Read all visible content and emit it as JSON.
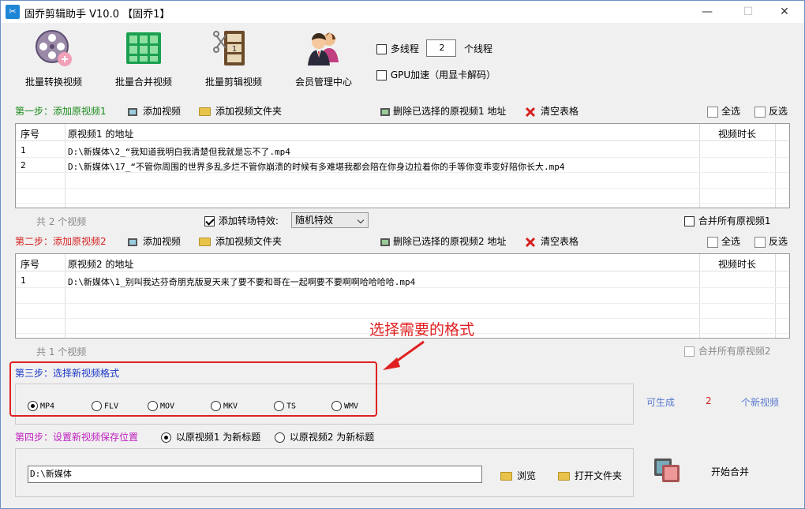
{
  "window": {
    "title": "固乔剪辑助手 V10.0  【固乔1】",
    "minimize": "—",
    "maximize": "☐",
    "close": "✕"
  },
  "toolbar": {
    "items": [
      {
        "label": "批量转换视频",
        "icon": "film-reel-icon"
      },
      {
        "label": "批量合并视频",
        "icon": "merge-grid-icon"
      },
      {
        "label": "批量剪辑视频",
        "icon": "film-scissors-icon"
      },
      {
        "label": "会员管理中心",
        "icon": "users-icon"
      }
    ],
    "multithread_label": "多线程",
    "thread_count": "2",
    "thread_unit": "个线程",
    "gpu_label": "GPU加速（用显卡解码）"
  },
  "step1": {
    "title": "第一步：添加原视频1",
    "add_video": "添加视频",
    "add_folder": "添加视频文件夹",
    "delete_selected": "删除已选择的原视频1 地址",
    "clear_table": "清空表格",
    "select_all": "全选",
    "invert": "反选",
    "columns": {
      "index": "序号",
      "address": "原视频1 的地址",
      "duration": "视频时长"
    },
    "rows": [
      {
        "index": "1",
        "address": "D:\\新媒体\\2_“我知道我明白我清楚但我就是忘不了.mp4"
      },
      {
        "index": "2",
        "address": "D:\\新媒体\\17_“不管你周围的世界多乱多烂不管你崩溃的时候有多难堪我都会陪在你身边拉着你的手等你变乖变好陪你长大.mp4"
      }
    ],
    "count": "共 2 个视频",
    "transition_label": "添加转场特效:",
    "transition_value": "随机特效",
    "merge_all": "合并所有原视频1"
  },
  "step2": {
    "title": "第二步：添加原视频2",
    "add_video": "添加视频",
    "add_folder": "添加视频文件夹",
    "delete_selected": "删除已选择的原视频2 地址",
    "clear_table": "清空表格",
    "select_all": "全选",
    "invert": "反选",
    "columns": {
      "index": "序号",
      "address": "原视频2 的地址",
      "duration": "视频时长"
    },
    "rows": [
      {
        "index": "1",
        "address": "D:\\新媒体\\1_别叫我达芬奇朋克版夏天来了要不要和哥在一起啊要不要啊啊哈哈哈哈.mp4"
      }
    ],
    "count": "共 1 个视频",
    "merge_all": "合并所有原视频2"
  },
  "annotation": "选择需要的格式",
  "step3": {
    "title": "第三步：选择新视频格式",
    "formats": [
      "MP4",
      "FLV",
      "MOV",
      "MKV",
      "TS",
      "WMV"
    ],
    "selected": "MP4",
    "can_generate": "可生成",
    "generate_count": "2",
    "new_videos": "个新视频"
  },
  "step4": {
    "title": "第四步：设置新视频保存位置",
    "option1": "以原视频1 为新标题",
    "option2": "以原视频2 为新标题",
    "path": "D:\\新媒体",
    "browse": "浏览",
    "open_folder": "打开文件夹",
    "start": "开始合并"
  },
  "colors": {
    "step1": "#1a8a1a",
    "step2": "#d62020",
    "step3": "#1a38c8",
    "step4": "#c020c0",
    "annotation": "#e02020"
  }
}
